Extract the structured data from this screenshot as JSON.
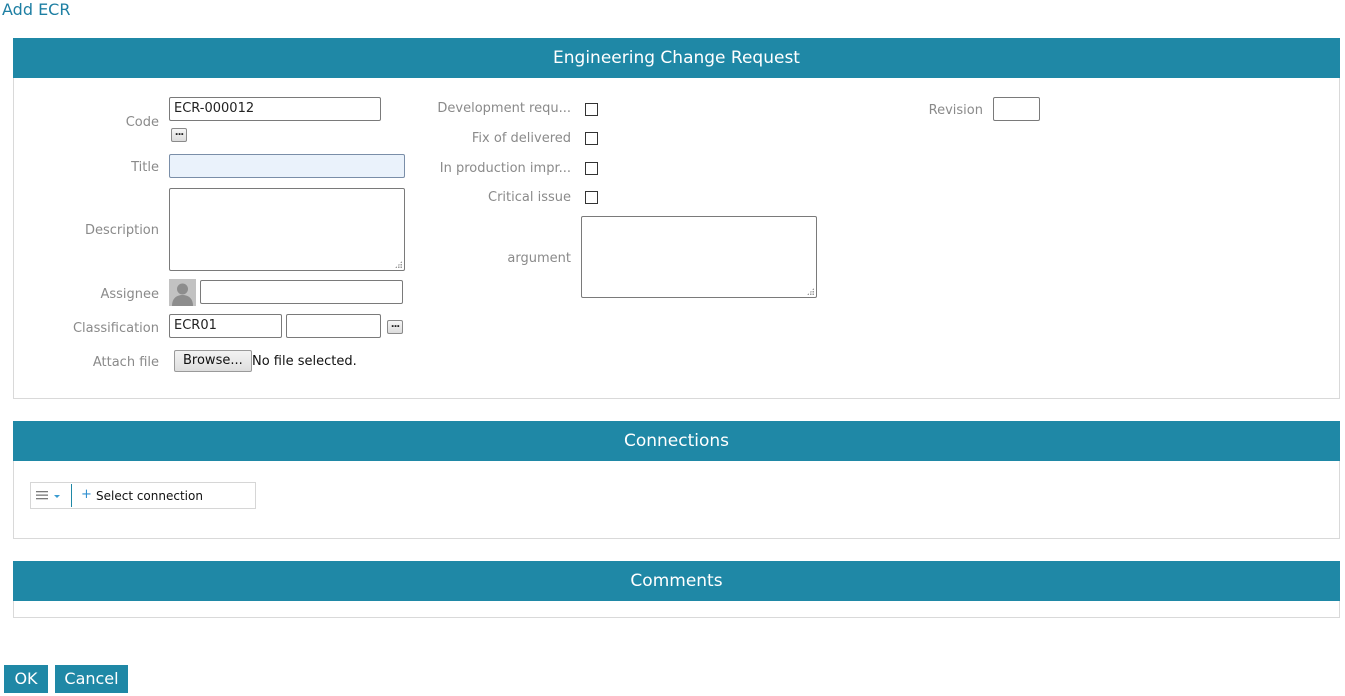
{
  "page_title": "Add ECR",
  "sections": {
    "ecr": {
      "header": "Engineering Change Request",
      "fields": {
        "code_label": "Code",
        "code_value": "ECR-000012",
        "code_button": "...",
        "title_label": "Title",
        "title_value": "",
        "description_label": "Description",
        "assignee_label": "Assignee",
        "assignee_value": "",
        "classification_label": "Classification",
        "classification_code": "ECR01",
        "classification_name": "",
        "classification_button": "...",
        "attach_label": "Attach file",
        "browse_label": "Browse...",
        "no_file_text": "No file selected."
      },
      "checkboxes": {
        "development_label": "Development requ...",
        "fix_label": "Fix of delivered",
        "production_label": "In production impr...",
        "critical_label": "Critical issue"
      },
      "argument_label": "argument",
      "revision_label": "Revision",
      "revision_value": ""
    },
    "connections": {
      "header": "Connections",
      "select_label": "Select connection",
      "menu_icon": "hamburger-menu-icon",
      "add_icon": "plus-icon"
    },
    "comments": {
      "header": "Comments"
    }
  },
  "buttons": {
    "ok": "OK",
    "cancel": "Cancel"
  },
  "colors": {
    "accent": "#1f88a6",
    "title_link": "#1e7fa3",
    "label": "#8a8a8a"
  }
}
